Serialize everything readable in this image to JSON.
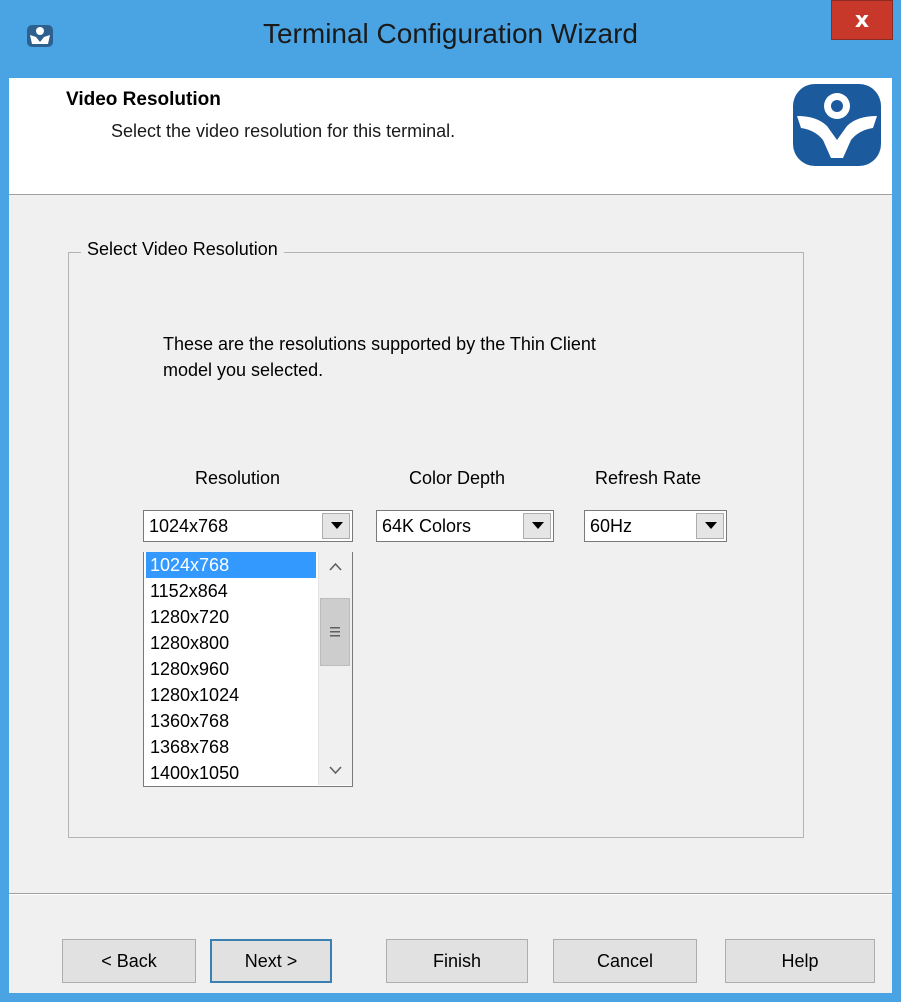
{
  "window": {
    "title": "Terminal Configuration Wizard",
    "close_label": "x"
  },
  "header": {
    "title": "Video Resolution",
    "subtitle": "Select the video resolution for this terminal."
  },
  "group": {
    "label": "Select Video Resolution",
    "info_line1": "These are the resolutions supported by the Thin Client",
    "info_line2": "model you selected."
  },
  "resolution": {
    "label": "Resolution",
    "value": "1024x768",
    "options": [
      "1024x768",
      "1152x864",
      "1280x720",
      "1280x800",
      "1280x960",
      "1280x1024",
      "1360x768",
      "1368x768",
      "1400x1050"
    ],
    "selected_index": 0
  },
  "color_depth": {
    "label": "Color Depth",
    "value": "64K Colors"
  },
  "refresh_rate": {
    "label": "Refresh Rate",
    "value": "60Hz"
  },
  "buttons": {
    "back": "< Back",
    "next": "Next >",
    "finish": "Finish",
    "cancel": "Cancel",
    "help": "Help"
  },
  "colors": {
    "frame": "#4aa3e3",
    "close": "#c7382b",
    "selection": "#3399ff",
    "logo": "#1c5a9e"
  },
  "icons": {
    "app": "thinmanager-icon",
    "logo": "thinmanager-logo",
    "dropdown": "chevron-down-icon",
    "scroll_up": "chevron-up-icon",
    "scroll_down": "chevron-down-icon"
  }
}
